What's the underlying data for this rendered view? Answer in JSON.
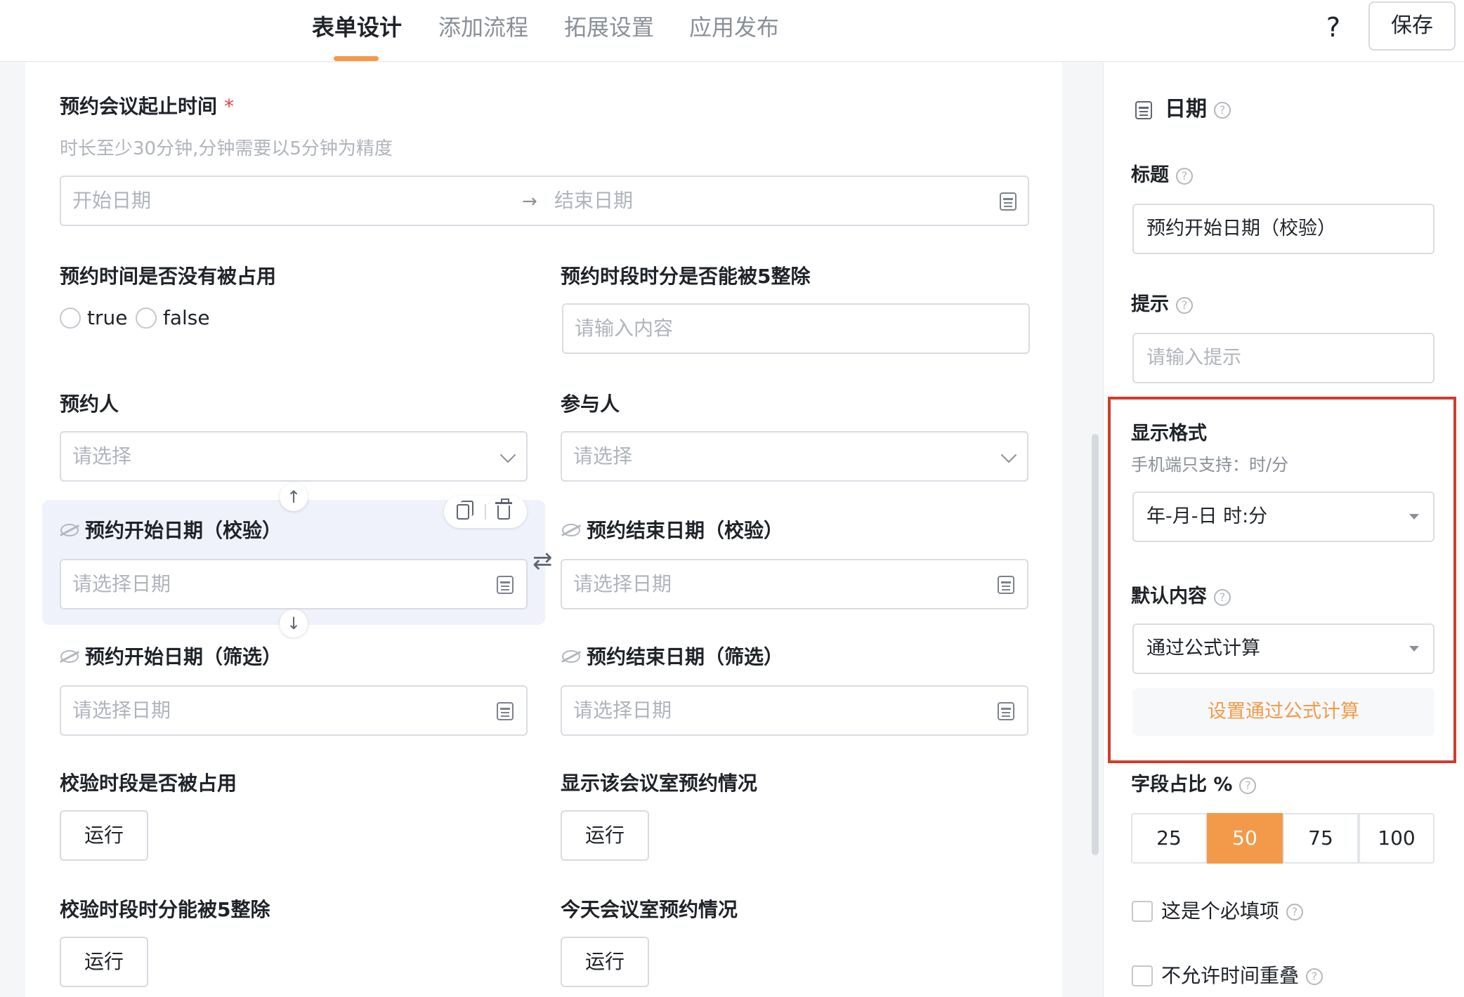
{
  "header": {
    "tabs": [
      {
        "label": "表单设计",
        "active": true
      },
      {
        "label": "添加流程",
        "active": false
      },
      {
        "label": "拓展设置",
        "active": false
      },
      {
        "label": "应用发布",
        "active": false
      }
    ],
    "help_label": "?",
    "save_label": "保存"
  },
  "form": {
    "range_field": {
      "label": "预约会议起止时间",
      "required_mark": "*",
      "hint": "时长至少30分钟,分钟需要以5分钟为精度",
      "start_placeholder": "开始日期",
      "end_placeholder": "结束日期",
      "separator": "→"
    },
    "occupied": {
      "label": "预约时间是否没有被占用",
      "options": [
        "true",
        "false"
      ]
    },
    "divisible": {
      "label": "预约时段时分是否能被5整除",
      "placeholder": "请输入内容"
    },
    "booker": {
      "label": "预约人",
      "placeholder": "请选择"
    },
    "participants": {
      "label": "参与人",
      "placeholder": "请选择"
    },
    "start_check": {
      "label": "预约开始日期（校验）",
      "placeholder": "请选择日期"
    },
    "end_check": {
      "label": "预约结束日期（校验）",
      "placeholder": "请选择日期"
    },
    "start_filter": {
      "label": "预约开始日期（筛选）",
      "placeholder": "请选择日期"
    },
    "end_filter": {
      "label": "预约结束日期（筛选）",
      "placeholder": "请选择日期"
    },
    "check_occupied": {
      "label": "校验时段是否被占用",
      "button": "运行"
    },
    "show_room": {
      "label": "显示该会议室预约情况",
      "button": "运行"
    },
    "check_divisible": {
      "label": "校验时段时分能被5整除",
      "button": "运行"
    },
    "today_room": {
      "label": "今天会议室预约情况",
      "button": "运行"
    }
  },
  "panel": {
    "title": "日期",
    "title_field": {
      "label": "标题",
      "value": "预约开始日期（校验）"
    },
    "hint_field": {
      "label": "提示",
      "placeholder": "请输入提示"
    },
    "format": {
      "label": "显示格式",
      "sub": "手机端只支持：时/分",
      "value": "年-月-日 时:分"
    },
    "default": {
      "label": "默认内容",
      "value": "通过公式计算",
      "formula_button": "设置通过公式计算"
    },
    "width": {
      "label": "字段占比 %",
      "options": [
        "25",
        "50",
        "75",
        "100"
      ],
      "selected": "50"
    },
    "required": {
      "label": "这是个必填项",
      "checked": false
    },
    "no_overlap": {
      "label": "不允许时间重叠",
      "checked": false
    }
  },
  "colors": {
    "accent": "#f29a49",
    "highlight_border": "#d33c2b",
    "selected_bg": "#eff2fb",
    "required": "#e64340"
  }
}
